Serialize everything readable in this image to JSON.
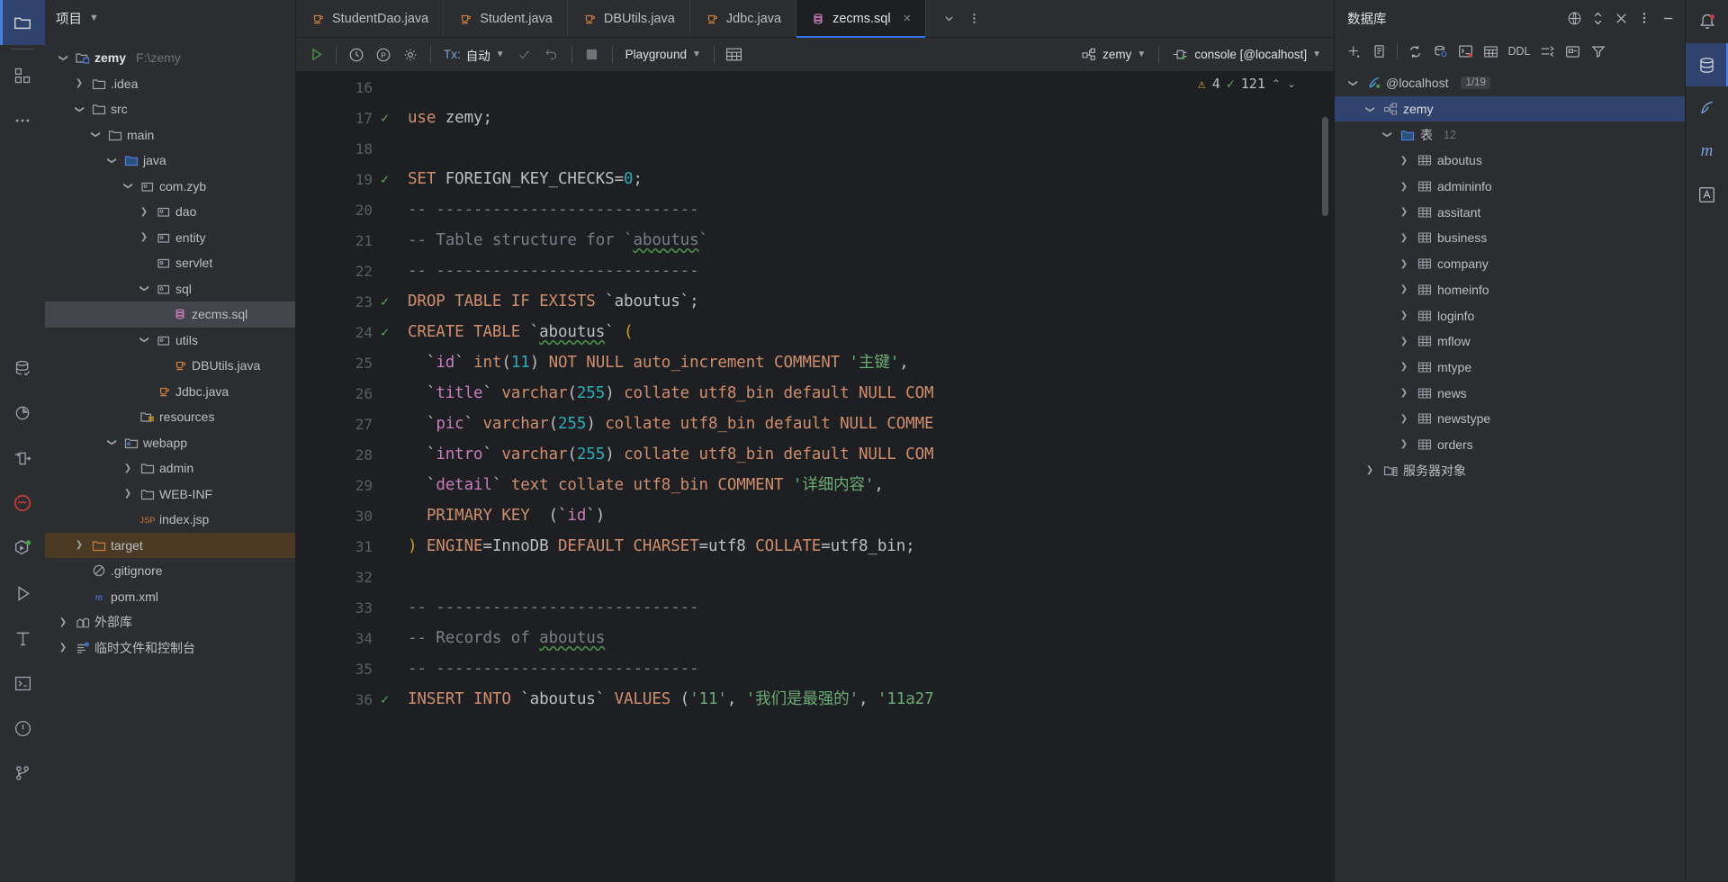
{
  "project": {
    "title": "项目",
    "tree": [
      {
        "depth": 0,
        "arrow": "down",
        "icon": "module-folder",
        "label": "zemy",
        "bold": true,
        "path": "F:\\zemy"
      },
      {
        "depth": 1,
        "arrow": "right",
        "icon": "folder",
        "label": ".idea"
      },
      {
        "depth": 1,
        "arrow": "down",
        "icon": "folder",
        "label": "src"
      },
      {
        "depth": 2,
        "arrow": "down",
        "icon": "folder",
        "label": "main"
      },
      {
        "depth": 3,
        "arrow": "down",
        "icon": "folder-blue",
        "label": "java"
      },
      {
        "depth": 4,
        "arrow": "down",
        "icon": "package",
        "label": "com.zyb"
      },
      {
        "depth": 5,
        "arrow": "right",
        "icon": "package",
        "label": "dao"
      },
      {
        "depth": 5,
        "arrow": "right",
        "icon": "package",
        "label": "entity"
      },
      {
        "depth": 5,
        "arrow": "none",
        "icon": "package",
        "label": "servlet"
      },
      {
        "depth": 5,
        "arrow": "down",
        "icon": "package",
        "label": "sql"
      },
      {
        "depth": 6,
        "arrow": "none",
        "icon": "sql-file",
        "label": "zecms.sql",
        "selected": true
      },
      {
        "depth": 5,
        "arrow": "down",
        "icon": "package",
        "label": "utils"
      },
      {
        "depth": 6,
        "arrow": "none",
        "icon": "java-file",
        "label": "DBUtils.java"
      },
      {
        "depth": 5,
        "arrow": "none",
        "icon": "java-file",
        "label": "Jdbc.java"
      },
      {
        "depth": 4,
        "arrow": "none",
        "icon": "resources-folder",
        "label": "resources"
      },
      {
        "depth": 3,
        "arrow": "down",
        "icon": "webapp-folder",
        "label": "webapp"
      },
      {
        "depth": 4,
        "arrow": "right",
        "icon": "folder",
        "label": "admin"
      },
      {
        "depth": 4,
        "arrow": "right",
        "icon": "folder",
        "label": "WEB-INF"
      },
      {
        "depth": 4,
        "arrow": "none",
        "icon": "jsp-file",
        "label": "index.jsp"
      },
      {
        "depth": 1,
        "arrow": "right",
        "icon": "folder-orange",
        "label": "target",
        "highlight": true
      },
      {
        "depth": 1,
        "arrow": "none",
        "icon": "gitignore-file",
        "label": ".gitignore"
      },
      {
        "depth": 1,
        "arrow": "none",
        "icon": "maven-file",
        "label": "pom.xml"
      },
      {
        "depth": 0,
        "arrow": "right",
        "icon": "library",
        "label": "外部库"
      },
      {
        "depth": 0,
        "arrow": "right",
        "icon": "scratches",
        "label": "临时文件和控制台"
      }
    ]
  },
  "activity_bar": {
    "items": [
      {
        "name": "project-tool-window",
        "icon": "folder-icon",
        "active": true
      },
      {
        "name": "structure-tool-window",
        "icon": "structure-icon",
        "active": false
      },
      {
        "name": "more-tool-windows",
        "icon": "more-icon",
        "active": false
      },
      {
        "name": "database-tool-window",
        "icon": "database-icon",
        "active": false
      },
      {
        "name": "profiler-tool-window",
        "icon": "pie-icon",
        "active": false
      },
      {
        "name": "endpoints-tool-window",
        "icon": "endpoints-icon",
        "active": false
      },
      {
        "name": "problems-tool-window",
        "icon": "problems-circle-icon",
        "active": false
      },
      {
        "name": "services-tool-window",
        "icon": "services-icon",
        "active": false
      },
      {
        "name": "run-tool-window",
        "icon": "run-icon",
        "active": false
      },
      {
        "name": "build-tool-window",
        "icon": "build-hammer-icon",
        "active": false
      },
      {
        "name": "terminal-tool-window",
        "icon": "terminal-icon",
        "active": false
      },
      {
        "name": "notifications-tool-window",
        "icon": "alert-icon",
        "active": false
      },
      {
        "name": "version-control-tool-window",
        "icon": "branch-icon",
        "active": false
      }
    ]
  },
  "tabs": [
    {
      "label": "StudentDao.java",
      "icon": "java-file",
      "active": false
    },
    {
      "label": "Student.java",
      "icon": "java-file",
      "active": false
    },
    {
      "label": "DBUtils.java",
      "icon": "java-file",
      "active": false
    },
    {
      "label": "Jdbc.java",
      "icon": "java-file",
      "active": false
    },
    {
      "label": "zecms.sql",
      "icon": "sql-file",
      "active": true,
      "closable": true
    }
  ],
  "tabbar_actions": [
    {
      "name": "tab-list-dropdown",
      "icon": "chevron-down-icon"
    },
    {
      "name": "tab-options-menu",
      "icon": "more-vertical-icon"
    }
  ],
  "sql_toolbar": {
    "run_label": "run-icon",
    "tx_prefix": "Tx:",
    "tx_value": "自动",
    "schema_label": "Playground",
    "datasource_label": "zemy",
    "console_label": "console [@localhost]",
    "buttons": [
      {
        "name": "execute-button",
        "icon": "run-green-icon"
      },
      {
        "name": "execution-history-button",
        "icon": "clock-icon"
      },
      {
        "name": "parameters-button",
        "icon": "p-circle-icon"
      },
      {
        "name": "settings-button",
        "icon": "gear-icon"
      },
      {
        "name": "commit-button",
        "icon": "check-icon",
        "disabled": true
      },
      {
        "name": "rollback-button",
        "icon": "rollback-icon",
        "disabled": true
      },
      {
        "name": "stop-button",
        "icon": "stop-square-icon"
      },
      {
        "name": "open-table-editor-button",
        "icon": "table-grid-icon"
      }
    ]
  },
  "editor": {
    "inspections": {
      "warnings": "4",
      "ok_count": "121"
    },
    "lines": [
      {
        "n": "16",
        "check": false,
        "tokens": []
      },
      {
        "n": "17",
        "check": true,
        "tokens": [
          {
            "t": "use",
            "c": "kw"
          },
          {
            "t": " ",
            "c": "plain"
          },
          {
            "t": "zemy",
            "c": "plain"
          },
          {
            "t": ";",
            "c": "punc"
          }
        ]
      },
      {
        "n": "18",
        "check": false,
        "tokens": []
      },
      {
        "n": "19",
        "check": true,
        "tokens": [
          {
            "t": "SET",
            "c": "kw"
          },
          {
            "t": " ",
            "c": "plain"
          },
          {
            "t": "FOREIGN_KEY_CHECKS",
            "c": "plain"
          },
          {
            "t": "=",
            "c": "punc"
          },
          {
            "t": "0",
            "c": "num"
          },
          {
            "t": ";",
            "c": "punc"
          }
        ]
      },
      {
        "n": "20",
        "check": false,
        "tokens": [
          {
            "t": "-- ----------------------------",
            "c": "cmt"
          }
        ]
      },
      {
        "n": "21",
        "check": false,
        "tokens": [
          {
            "t": "-- Table structure for `",
            "c": "cmt"
          },
          {
            "t": "aboutus",
            "c": "cmt",
            "wavy": true
          },
          {
            "t": "`",
            "c": "cmt"
          }
        ]
      },
      {
        "n": "22",
        "check": false,
        "tokens": [
          {
            "t": "-- ----------------------------",
            "c": "cmt"
          }
        ]
      },
      {
        "n": "23",
        "check": true,
        "tokens": [
          {
            "t": "DROP TABLE IF EXISTS",
            "c": "kw"
          },
          {
            "t": " `",
            "c": "plain"
          },
          {
            "t": "aboutus",
            "c": "plain"
          },
          {
            "t": "`;",
            "c": "plain"
          }
        ]
      },
      {
        "n": "24",
        "check": true,
        "tokens": [
          {
            "t": "CREATE TABLE",
            "c": "kw"
          },
          {
            "t": " `",
            "c": "plain"
          },
          {
            "t": "aboutus",
            "c": "plain",
            "wavy": true
          },
          {
            "t": "` ",
            "c": "plain"
          },
          {
            "t": "(",
            "c": "paren"
          }
        ]
      },
      {
        "n": "25",
        "check": false,
        "tokens": [
          {
            "t": "  `",
            "c": "plain"
          },
          {
            "t": "id",
            "c": "id"
          },
          {
            "t": "` ",
            "c": "plain"
          },
          {
            "t": "int",
            "c": "kw"
          },
          {
            "t": "(",
            "c": "plain"
          },
          {
            "t": "11",
            "c": "num"
          },
          {
            "t": ") ",
            "c": "plain"
          },
          {
            "t": "NOT NULL auto_increment COMMENT ",
            "c": "kw"
          },
          {
            "t": "'主键'",
            "c": "str"
          },
          {
            "t": ",",
            "c": "punc"
          }
        ]
      },
      {
        "n": "26",
        "check": false,
        "tokens": [
          {
            "t": "  `",
            "c": "plain"
          },
          {
            "t": "title",
            "c": "id"
          },
          {
            "t": "` ",
            "c": "plain"
          },
          {
            "t": "varchar",
            "c": "kw"
          },
          {
            "t": "(",
            "c": "plain"
          },
          {
            "t": "255",
            "c": "num"
          },
          {
            "t": ") ",
            "c": "plain"
          },
          {
            "t": "collate utf8_bin default NULL COM",
            "c": "kw"
          }
        ]
      },
      {
        "n": "27",
        "check": false,
        "tokens": [
          {
            "t": "  `",
            "c": "plain"
          },
          {
            "t": "pic",
            "c": "id"
          },
          {
            "t": "` ",
            "c": "plain"
          },
          {
            "t": "varchar",
            "c": "kw"
          },
          {
            "t": "(",
            "c": "plain"
          },
          {
            "t": "255",
            "c": "num"
          },
          {
            "t": ") ",
            "c": "plain"
          },
          {
            "t": "collate utf8_bin default NULL COMME",
            "c": "kw"
          }
        ]
      },
      {
        "n": "28",
        "check": false,
        "tokens": [
          {
            "t": "  `",
            "c": "plain"
          },
          {
            "t": "intro",
            "c": "id"
          },
          {
            "t": "` ",
            "c": "plain"
          },
          {
            "t": "varchar",
            "c": "kw"
          },
          {
            "t": "(",
            "c": "plain"
          },
          {
            "t": "255",
            "c": "num"
          },
          {
            "t": ") ",
            "c": "plain"
          },
          {
            "t": "collate utf8_bin default NULL COM",
            "c": "kw"
          }
        ]
      },
      {
        "n": "29",
        "check": false,
        "tokens": [
          {
            "t": "  `",
            "c": "plain"
          },
          {
            "t": "detail",
            "c": "id"
          },
          {
            "t": "` ",
            "c": "plain"
          },
          {
            "t": "text collate utf8_bin COMMENT ",
            "c": "kw"
          },
          {
            "t": "'详细内容'",
            "c": "str"
          },
          {
            "t": ",",
            "c": "punc"
          }
        ]
      },
      {
        "n": "30",
        "check": false,
        "tokens": [
          {
            "t": "  ",
            "c": "plain"
          },
          {
            "t": "PRIMARY KEY",
            "c": "kw"
          },
          {
            "t": "  (`",
            "c": "plain"
          },
          {
            "t": "id",
            "c": "id"
          },
          {
            "t": "`)",
            "c": "plain"
          }
        ]
      },
      {
        "n": "31",
        "check": false,
        "tokens": [
          {
            "t": ")",
            "c": "paren"
          },
          {
            "t": " ",
            "c": "plain"
          },
          {
            "t": "ENGINE",
            "c": "kw"
          },
          {
            "t": "=",
            "c": "punc"
          },
          {
            "t": "InnoDB ",
            "c": "plain"
          },
          {
            "t": "DEFAULT CHARSET",
            "c": "kw"
          },
          {
            "t": "=",
            "c": "punc"
          },
          {
            "t": "utf8 ",
            "c": "plain"
          },
          {
            "t": "COLLATE",
            "c": "kw"
          },
          {
            "t": "=",
            "c": "punc"
          },
          {
            "t": "utf8_bin;",
            "c": "plain"
          }
        ]
      },
      {
        "n": "32",
        "check": false,
        "tokens": []
      },
      {
        "n": "33",
        "check": false,
        "tokens": [
          {
            "t": "-- ----------------------------",
            "c": "cmt"
          }
        ]
      },
      {
        "n": "34",
        "check": false,
        "tokens": [
          {
            "t": "-- Records of ",
            "c": "cmt"
          },
          {
            "t": "aboutus",
            "c": "cmt",
            "wavy": true
          }
        ]
      },
      {
        "n": "35",
        "check": false,
        "tokens": [
          {
            "t": "-- ----------------------------",
            "c": "cmt"
          }
        ]
      },
      {
        "n": "36",
        "check": true,
        "tokens": [
          {
            "t": "INSERT INTO",
            "c": "kw"
          },
          {
            "t": " `",
            "c": "plain"
          },
          {
            "t": "aboutus",
            "c": "plain"
          },
          {
            "t": "` ",
            "c": "plain"
          },
          {
            "t": "VALUES",
            "c": "kw"
          },
          {
            "t": " (",
            "c": "plain"
          },
          {
            "t": "'11'",
            "c": "str"
          },
          {
            "t": ", ",
            "c": "punc"
          },
          {
            "t": "'我们是最强的'",
            "c": "str"
          },
          {
            "t": ", ",
            "c": "punc"
          },
          {
            "t": "'11a27",
            "c": "str"
          }
        ]
      }
    ]
  },
  "database": {
    "title": "数据库",
    "header_icons": [
      {
        "name": "data-sources-help-icon",
        "icon": "globe-icon"
      },
      {
        "name": "expand-collapse-icon",
        "icon": "updown-icon"
      },
      {
        "name": "hide-panel-icon",
        "icon": "close-x-icon"
      },
      {
        "name": "panel-options-icon",
        "icon": "more-vertical-icon"
      },
      {
        "name": "minimize-panel-icon",
        "icon": "minus-icon"
      }
    ],
    "toolbar": [
      {
        "name": "new-data-source-button",
        "icon": "plus-icon"
      },
      {
        "name": "duplicate-button",
        "icon": "copy-icon"
      },
      {
        "name": "refresh-button",
        "icon": "refresh-icon"
      },
      {
        "name": "data-source-properties-button",
        "icon": "database-gear-icon"
      },
      {
        "name": "jump-to-query-console-button",
        "icon": "console-icon"
      },
      {
        "name": "table-editor-button",
        "icon": "table-grid-icon"
      },
      {
        "name": "ddl-button",
        "icon": "ddl-label",
        "label": "DDL"
      },
      {
        "name": "modify-button",
        "icon": "modify-icon"
      },
      {
        "name": "diagram-button",
        "icon": "diagram-icon"
      },
      {
        "name": "filter-button",
        "icon": "filter-icon"
      }
    ],
    "tree": [
      {
        "depth": 0,
        "arrow": "down",
        "icon": "mysql-conn",
        "label": "@localhost",
        "badge": "1/19"
      },
      {
        "depth": 1,
        "arrow": "down",
        "icon": "schema",
        "label": "zemy",
        "selected": true
      },
      {
        "depth": 2,
        "arrow": "down",
        "icon": "folder-blue",
        "label": "表",
        "count": "12"
      },
      {
        "depth": 3,
        "arrow": "right",
        "icon": "table",
        "label": "aboutus"
      },
      {
        "depth": 3,
        "arrow": "right",
        "icon": "table",
        "label": "admininfo"
      },
      {
        "depth": 3,
        "arrow": "right",
        "icon": "table",
        "label": "assitant"
      },
      {
        "depth": 3,
        "arrow": "right",
        "icon": "table",
        "label": "business"
      },
      {
        "depth": 3,
        "arrow": "right",
        "icon": "table",
        "label": "company"
      },
      {
        "depth": 3,
        "arrow": "right",
        "icon": "table",
        "label": "homeinfo"
      },
      {
        "depth": 3,
        "arrow": "right",
        "icon": "table",
        "label": "loginfo"
      },
      {
        "depth": 3,
        "arrow": "right",
        "icon": "table",
        "label": "mflow"
      },
      {
        "depth": 3,
        "arrow": "right",
        "icon": "table",
        "label": "mtype"
      },
      {
        "depth": 3,
        "arrow": "right",
        "icon": "table",
        "label": "news"
      },
      {
        "depth": 3,
        "arrow": "right",
        "icon": "table",
        "label": "newstype"
      },
      {
        "depth": 3,
        "arrow": "right",
        "icon": "table",
        "label": "orders"
      },
      {
        "depth": 1,
        "arrow": "right",
        "icon": "server-objects",
        "label": "服务器对象"
      }
    ]
  },
  "right_bar": {
    "items": [
      {
        "name": "notifications-button",
        "icon": "bell-icon",
        "active": false
      },
      {
        "name": "database-tool-button",
        "icon": "database-icon",
        "active": true
      },
      {
        "name": "ai-assistant-button",
        "icon": "feather-icon",
        "active": false
      },
      {
        "name": "maven-tool-button",
        "icon": "maven-m-icon",
        "active": false
      },
      {
        "name": "ui-designer-button",
        "icon": "ui-a-icon",
        "active": false
      }
    ]
  },
  "colors": {
    "accent": "#3574f0",
    "selection": "#2f436e",
    "background": "#2b2d30",
    "editor_bg": "#1e1f22",
    "keyword": "#cf8e6d",
    "string": "#6aab73",
    "number": "#2aacb8",
    "comment": "#7a7e85",
    "identifier": "#c77dbb"
  }
}
